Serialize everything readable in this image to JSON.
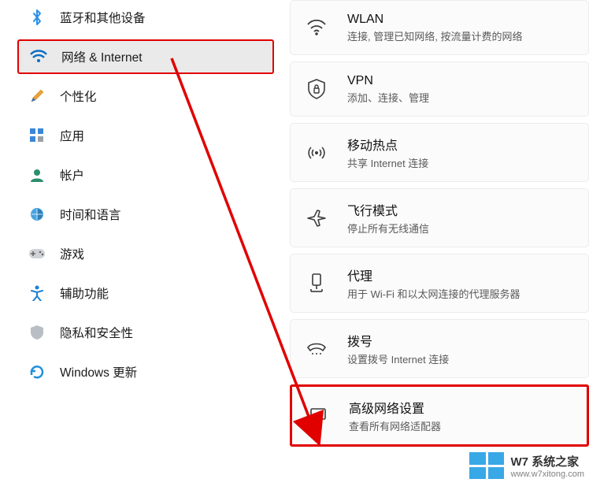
{
  "sidebar": {
    "items": [
      {
        "id": "bluetooth",
        "label": "蓝牙和其他设备"
      },
      {
        "id": "network",
        "label": "网络 & Internet",
        "selected": true,
        "highlighted": true
      },
      {
        "id": "personalize",
        "label": "个性化"
      },
      {
        "id": "apps",
        "label": "应用"
      },
      {
        "id": "accounts",
        "label": "帐户"
      },
      {
        "id": "time",
        "label": "时间和语言"
      },
      {
        "id": "gaming",
        "label": "游戏"
      },
      {
        "id": "accessibility",
        "label": "辅助功能"
      },
      {
        "id": "privacy",
        "label": "隐私和安全性"
      },
      {
        "id": "update",
        "label": "Windows 更新"
      }
    ]
  },
  "panel": {
    "items": [
      {
        "id": "wlan",
        "title": "WLAN",
        "sub": "连接, 管理已知网络, 按流量计费的网络"
      },
      {
        "id": "vpn",
        "title": "VPN",
        "sub": "添加、连接、管理"
      },
      {
        "id": "hotspot",
        "title": "移动热点",
        "sub": "共享 Internet 连接"
      },
      {
        "id": "airplane",
        "title": "飞行模式",
        "sub": "停止所有无线通信"
      },
      {
        "id": "proxy",
        "title": "代理",
        "sub": "用于 Wi-Fi 和以太网连接的代理服务器"
      },
      {
        "id": "dialup",
        "title": "拨号",
        "sub": "设置拨号 Internet 连接"
      },
      {
        "id": "advanced",
        "title": "高级网络设置",
        "sub": "查看所有网络适配器",
        "highlighted": true
      }
    ]
  },
  "watermark": {
    "title": "W7 系统之家",
    "url": "www.w7xitong.com"
  },
  "colors": {
    "highlight": "#e10000",
    "selectedBg": "#eaeaea",
    "accentBlue": "#0a6fc2"
  }
}
